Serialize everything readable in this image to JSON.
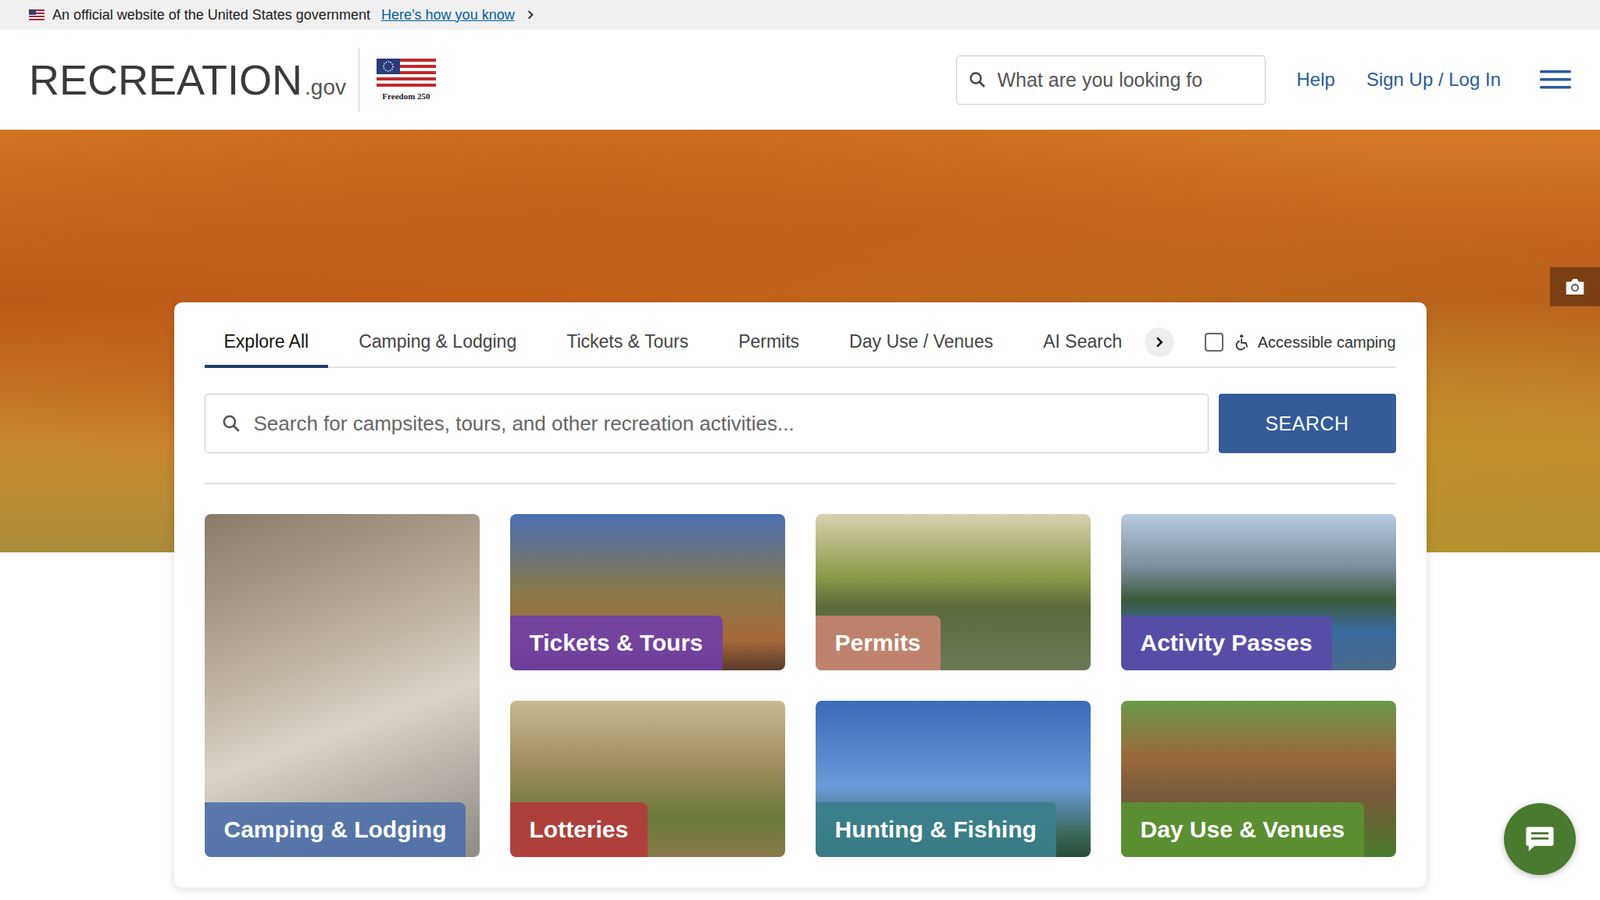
{
  "gov_banner": {
    "text": "An official website of the United States government",
    "link": "Here’s how you know"
  },
  "header": {
    "logo": "RECREATION",
    "logo_suffix": ".gov",
    "badge": "Freedom 250",
    "search": {
      "placeholder": "What are you looking fo"
    },
    "links": [
      "Help",
      "Sign Up / Log In"
    ]
  },
  "tabs": [
    {
      "label": "Explore All",
      "selected": true
    },
    {
      "label": "Camping & Lodging",
      "selected": false
    },
    {
      "label": "Tickets & Tours",
      "selected": false
    },
    {
      "label": "Permits",
      "selected": false
    },
    {
      "label": "Day Use / Venues",
      "selected": false
    },
    {
      "label": "AI Search",
      "selected": false
    }
  ],
  "accessible_filter": {
    "label": "Accessible camping",
    "checked": false
  },
  "search": {
    "placeholder": "Search for campsites, tours, and other recreation activities...",
    "button": "SEARCH"
  },
  "categories": [
    {
      "label": "Camping & Lodging",
      "color": "#4d6fa8"
    },
    {
      "label": "Tickets & Tours",
      "color": "#6e3fa8"
    },
    {
      "label": "Permits",
      "color": "#c98470"
    },
    {
      "label": "Activity Passes",
      "color": "#5a4aa8"
    },
    {
      "label": "Lotteries",
      "color": "#b43a3a"
    },
    {
      "label": "Hunting & Fishing",
      "color": "#3a7f8c"
    },
    {
      "label": "Day Use & Venues",
      "color": "#5b9233"
    }
  ]
}
